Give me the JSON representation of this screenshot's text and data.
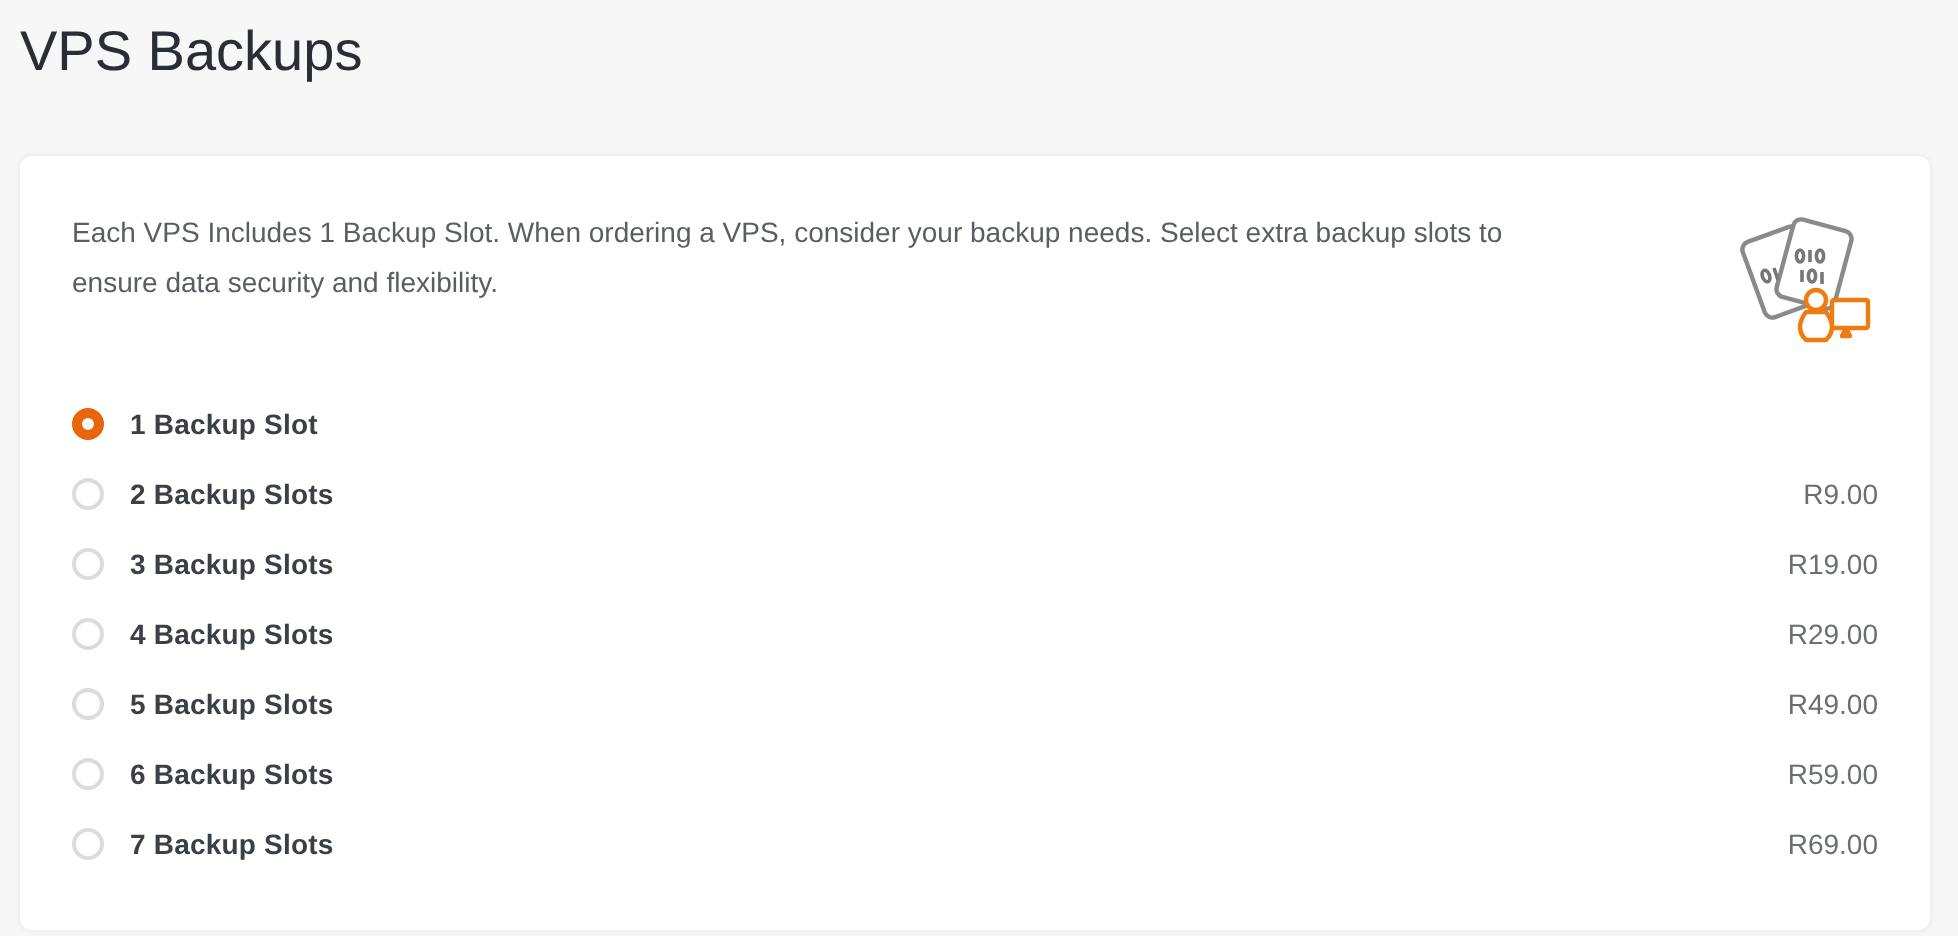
{
  "page_title": "VPS Backups",
  "description": "Each VPS Includes 1 Backup Slot. When ordering a VPS, consider your backup needs. Select extra backup slots to ensure data security and flexibility.",
  "options": [
    {
      "label": "1 Backup Slot",
      "selected": true
    },
    {
      "label": "2 Backup Slots",
      "price": "R9.00",
      "selected": false
    },
    {
      "label": "3 Backup Slots",
      "price": "R19.00",
      "selected": false
    },
    {
      "label": "4 Backup Slots",
      "price": "R29.00",
      "selected": false
    },
    {
      "label": "5 Backup Slots",
      "price": "R49.00",
      "selected": false
    },
    {
      "label": "6 Backup Slots",
      "price": "R59.00",
      "selected": false
    },
    {
      "label": "7 Backup Slots",
      "price": "R69.00",
      "selected": false
    }
  ]
}
